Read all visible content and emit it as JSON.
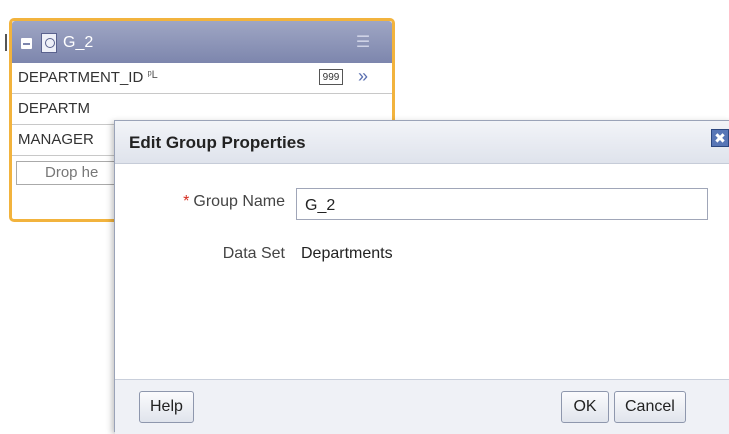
{
  "group": {
    "title": "G_2",
    "fields": [
      {
        "name": "DEPARTMENT_ID",
        "key_icon": "ᵖL",
        "type_badge": "999"
      },
      {
        "name": "DEPARTM",
        "key_icon": "",
        "type_badge": ""
      },
      {
        "name": "MANAGER",
        "key_icon": "",
        "type_badge": ""
      }
    ],
    "drop_zone": "Drop he",
    "chevron": "»"
  },
  "dialog": {
    "title": "Edit Group Properties",
    "close_glyph": "✖",
    "group_name_label": "Group Name",
    "required_marker": "*",
    "group_name_value": "G_2",
    "data_set_label": "Data Set",
    "data_set_value": "Departments",
    "help_label": "Help",
    "ok_label": "OK",
    "cancel_label": "Cancel"
  },
  "colors": {
    "panel_border": "#f2b33d",
    "panel_header": "#8a92b6",
    "close_button": "#5876b6"
  }
}
